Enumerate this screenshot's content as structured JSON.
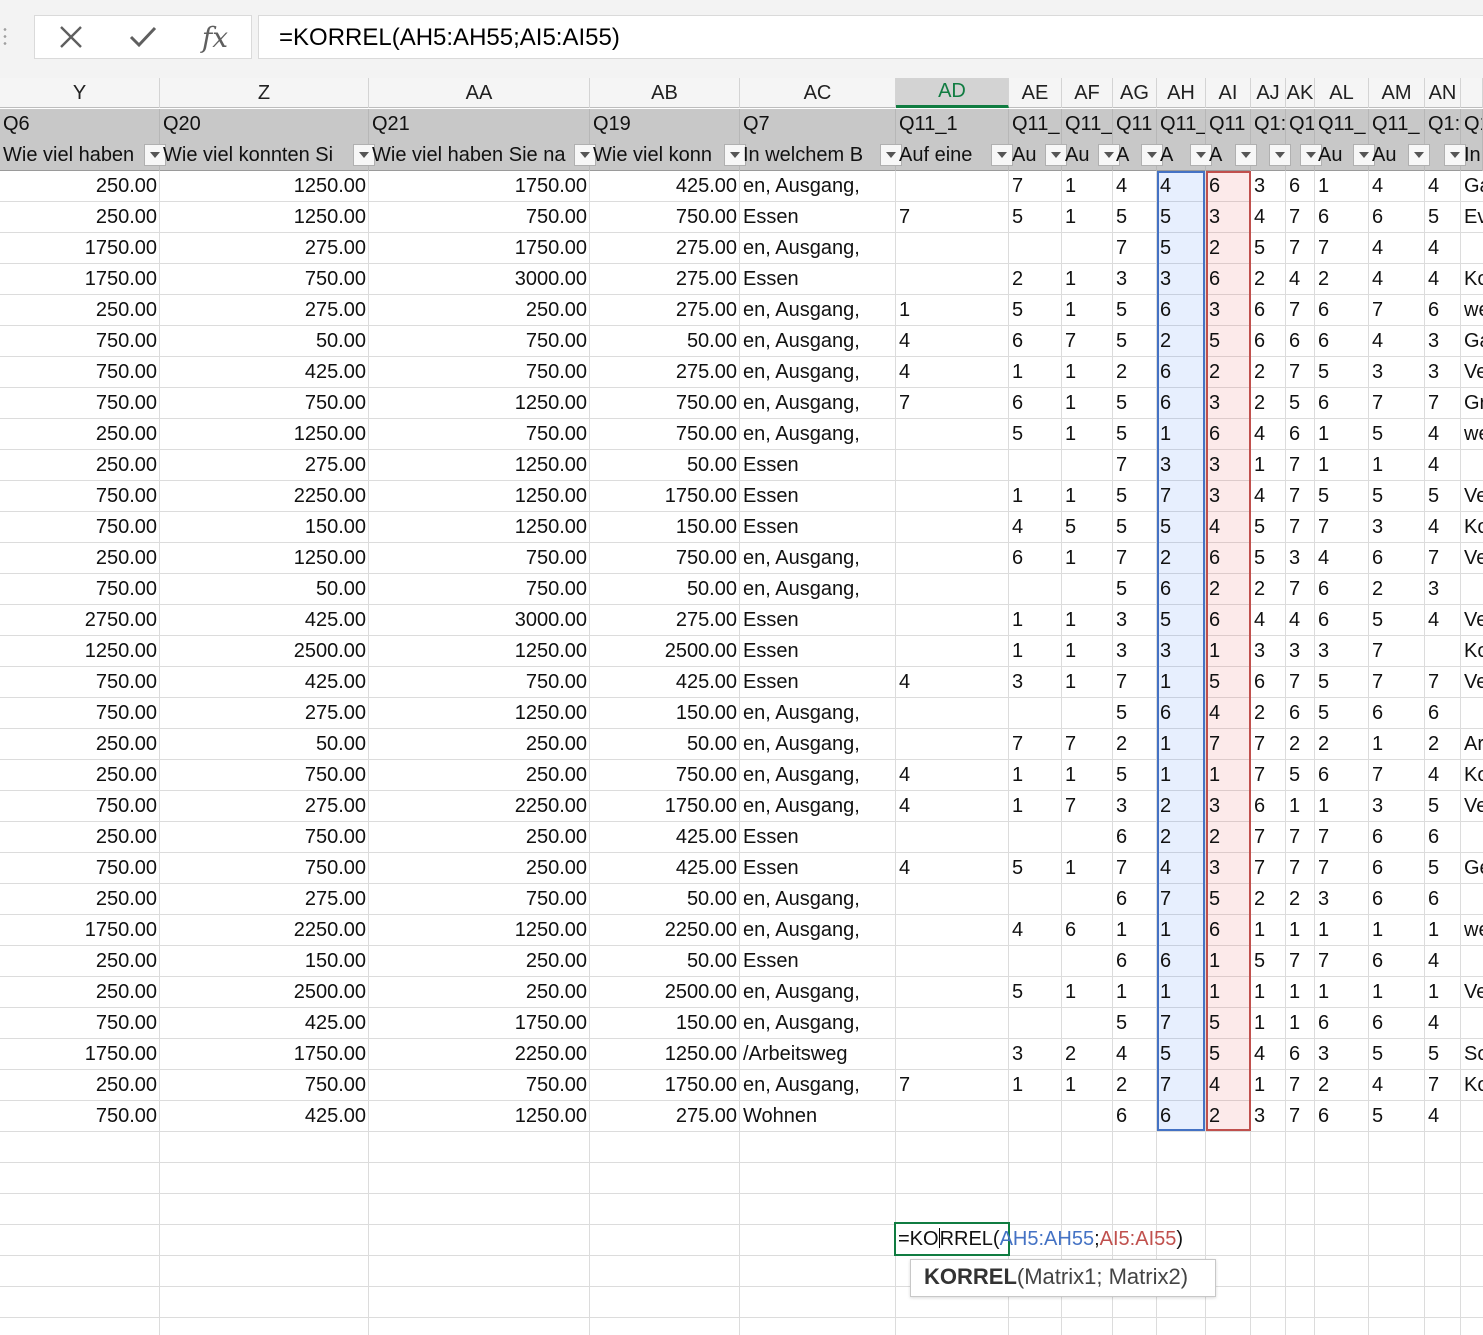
{
  "formula_bar": {
    "cancel_icon": "close-icon",
    "confirm_icon": "checkmark-icon",
    "fx_label": "fx",
    "formula": "=KORREL(AH5:AH55;AI5:AI55)"
  },
  "columns": [
    {
      "id": "col-y",
      "letter": "Y",
      "h1": "Q6",
      "h2": "Wie viel haben",
      "type": "num"
    },
    {
      "id": "col-z",
      "letter": "Z",
      "h1": "Q20",
      "h2": "Wie viel konnten Si",
      "type": "num"
    },
    {
      "id": "col-aa",
      "letter": "AA",
      "h1": "Q21",
      "h2": "Wie viel haben Sie na",
      "type": "num"
    },
    {
      "id": "col-ab",
      "letter": "AB",
      "h1": "Q19",
      "h2": "Wie viel konn",
      "type": "num"
    },
    {
      "id": "col-ac",
      "letter": "AC",
      "h1": "Q7",
      "h2": "In welchem B",
      "type": "txt"
    },
    {
      "id": "col-ad",
      "letter": "AD",
      "h1": "Q11_1",
      "h2": "Auf eine",
      "type": "txt"
    },
    {
      "id": "col-ae",
      "letter": "AE",
      "h1": "Q11_",
      "h2": "Au",
      "type": "txt"
    },
    {
      "id": "col-af",
      "letter": "AF",
      "h1": "Q11_",
      "h2": "Au",
      "type": "txt"
    },
    {
      "id": "col-ag",
      "letter": "AG",
      "h1": "Q11",
      "h2": "A",
      "type": "txt"
    },
    {
      "id": "col-ah",
      "letter": "AH",
      "h1": "Q11_",
      "h2": "A",
      "type": "txt"
    },
    {
      "id": "col-ai",
      "letter": "AI",
      "h1": "Q11",
      "h2": "A",
      "type": "txt"
    },
    {
      "id": "col-aj",
      "letter": "AJ",
      "h1": "Q1:",
      "h2": "",
      "type": "txt"
    },
    {
      "id": "col-ak",
      "letter": "AK",
      "h1": "Q1",
      "h2": "",
      "type": "txt"
    },
    {
      "id": "col-al",
      "letter": "AL",
      "h1": "Q11_",
      "h2": "Au",
      "type": "txt"
    },
    {
      "id": "col-am",
      "letter": "AM",
      "h1": "Q11_",
      "h2": "Au",
      "type": "txt"
    },
    {
      "id": "col-an",
      "letter": "AN",
      "h1": "Q1:",
      "h2": "",
      "type": "txt"
    },
    {
      "id": "col-ao",
      "letter": "",
      "h1": "Q1",
      "h2": "In",
      "type": "txt"
    }
  ],
  "active_column": "AD",
  "rows": [
    [
      "250.00",
      "1250.00",
      "1750.00",
      "425.00",
      "en, Ausgang,",
      "",
      "7",
      "1",
      "4",
      "4",
      "6",
      "3",
      "6",
      "1",
      "4",
      "4",
      "Ga"
    ],
    [
      "250.00",
      "1250.00",
      "750.00",
      "750.00",
      "Essen",
      "7",
      "5",
      "1",
      "5",
      "5",
      "3",
      "4",
      "7",
      "6",
      "6",
      "5",
      "Ev"
    ],
    [
      "1750.00",
      "275.00",
      "1750.00",
      "275.00",
      "en, Ausgang,",
      "",
      "",
      "",
      "7",
      "5",
      "2",
      "5",
      "7",
      "7",
      "4",
      "4",
      ""
    ],
    [
      "1750.00",
      "750.00",
      "3000.00",
      "275.00",
      "Essen",
      "",
      "2",
      "1",
      "3",
      "3",
      "6",
      "2",
      "4",
      "2",
      "4",
      "4",
      "Ko"
    ],
    [
      "250.00",
      "275.00",
      "250.00",
      "275.00",
      "en, Ausgang,",
      "1",
      "5",
      "1",
      "5",
      "6",
      "3",
      "6",
      "7",
      "6",
      "7",
      "6",
      "we"
    ],
    [
      "750.00",
      "50.00",
      "750.00",
      "50.00",
      "en, Ausgang,",
      "4",
      "6",
      "7",
      "5",
      "2",
      "5",
      "6",
      "6",
      "6",
      "4",
      "3",
      "Ga"
    ],
    [
      "750.00",
      "425.00",
      "750.00",
      "275.00",
      "en, Ausgang,",
      "4",
      "1",
      "1",
      "2",
      "6",
      "2",
      "2",
      "7",
      "5",
      "3",
      "3",
      "Ve"
    ],
    [
      "750.00",
      "750.00",
      "1250.00",
      "750.00",
      "en, Ausgang,",
      "7",
      "6",
      "1",
      "5",
      "6",
      "3",
      "2",
      "5",
      "6",
      "7",
      "7",
      "Gr"
    ],
    [
      "250.00",
      "1250.00",
      "750.00",
      "750.00",
      "en, Ausgang,",
      "",
      "5",
      "1",
      "5",
      "1",
      "6",
      "4",
      "6",
      "1",
      "5",
      "4",
      "we"
    ],
    [
      "250.00",
      "275.00",
      "1250.00",
      "50.00",
      "Essen",
      "",
      "",
      "",
      "7",
      "3",
      "3",
      "1",
      "7",
      "1",
      "1",
      "4",
      ""
    ],
    [
      "750.00",
      "2250.00",
      "1250.00",
      "1750.00",
      "Essen",
      "",
      "1",
      "1",
      "5",
      "7",
      "3",
      "4",
      "7",
      "5",
      "5",
      "5",
      "Ve"
    ],
    [
      "750.00",
      "150.00",
      "1250.00",
      "150.00",
      "Essen",
      "",
      "4",
      "5",
      "5",
      "5",
      "4",
      "5",
      "7",
      "7",
      "3",
      "4",
      "Ko"
    ],
    [
      "250.00",
      "1250.00",
      "750.00",
      "750.00",
      "en, Ausgang,",
      "",
      "6",
      "1",
      "7",
      "2",
      "6",
      "5",
      "3",
      "4",
      "6",
      "7",
      "Ve"
    ],
    [
      "750.00",
      "50.00",
      "750.00",
      "50.00",
      "en, Ausgang,",
      "",
      "",
      "",
      "5",
      "6",
      "2",
      "2",
      "7",
      "6",
      "2",
      "3",
      ""
    ],
    [
      "2750.00",
      "425.00",
      "3000.00",
      "275.00",
      "Essen",
      "",
      "1",
      "1",
      "3",
      "5",
      "6",
      "4",
      "4",
      "6",
      "5",
      "4",
      "Ve"
    ],
    [
      "1250.00",
      "2500.00",
      "1250.00",
      "2500.00",
      "Essen",
      "",
      "1",
      "1",
      "3",
      "3",
      "1",
      "3",
      "3",
      "3",
      "7",
      "",
      "Ko"
    ],
    [
      "750.00",
      "425.00",
      "750.00",
      "425.00",
      "Essen",
      "4",
      "3",
      "1",
      "7",
      "1",
      "5",
      "6",
      "7",
      "5",
      "7",
      "7",
      "Ve"
    ],
    [
      "750.00",
      "275.00",
      "1250.00",
      "150.00",
      "en, Ausgang,",
      "",
      "",
      "",
      "5",
      "6",
      "4",
      "2",
      "6",
      "5",
      "6",
      "6",
      ""
    ],
    [
      "250.00",
      "50.00",
      "250.00",
      "50.00",
      "en, Ausgang,",
      "",
      "7",
      "7",
      "2",
      "1",
      "7",
      "7",
      "2",
      "2",
      "1",
      "2",
      "Ar"
    ],
    [
      "250.00",
      "750.00",
      "250.00",
      "750.00",
      "en, Ausgang,",
      "4",
      "1",
      "1",
      "5",
      "1",
      "1",
      "7",
      "5",
      "6",
      "7",
      "4",
      "Ko"
    ],
    [
      "750.00",
      "275.00",
      "2250.00",
      "1750.00",
      "en, Ausgang,",
      "4",
      "1",
      "7",
      "3",
      "2",
      "3",
      "6",
      "1",
      "1",
      "3",
      "5",
      "Ve"
    ],
    [
      "250.00",
      "750.00",
      "250.00",
      "425.00",
      "Essen",
      "",
      "",
      "",
      "6",
      "2",
      "2",
      "7",
      "7",
      "7",
      "6",
      "6",
      ""
    ],
    [
      "750.00",
      "750.00",
      "250.00",
      "425.00",
      "Essen",
      "4",
      "5",
      "1",
      "7",
      "4",
      "3",
      "7",
      "7",
      "7",
      "6",
      "5",
      "Ge"
    ],
    [
      "250.00",
      "275.00",
      "750.00",
      "50.00",
      "en, Ausgang,",
      "",
      "",
      "",
      "6",
      "7",
      "5",
      "2",
      "2",
      "3",
      "6",
      "6",
      ""
    ],
    [
      "1750.00",
      "2250.00",
      "1250.00",
      "2250.00",
      "en, Ausgang,",
      "",
      "4",
      "6",
      "1",
      "1",
      "6",
      "1",
      "1",
      "1",
      "1",
      "1",
      "we"
    ],
    [
      "250.00",
      "150.00",
      "250.00",
      "50.00",
      "Essen",
      "",
      "",
      "",
      "6",
      "6",
      "1",
      "5",
      "7",
      "7",
      "6",
      "4",
      ""
    ],
    [
      "250.00",
      "2500.00",
      "250.00",
      "2500.00",
      "en, Ausgang,",
      "",
      "5",
      "1",
      "1",
      "1",
      "1",
      "1",
      "1",
      "1",
      "1",
      "1",
      "Ve"
    ],
    [
      "750.00",
      "425.00",
      "1750.00",
      "150.00",
      "en, Ausgang,",
      "",
      "",
      "",
      "5",
      "7",
      "5",
      "1",
      "1",
      "6",
      "6",
      "4",
      ""
    ],
    [
      "1750.00",
      "1750.00",
      "2250.00",
      "1250.00",
      "/Arbeitsweg",
      "",
      "3",
      "2",
      "4",
      "5",
      "5",
      "4",
      "6",
      "3",
      "5",
      "5",
      "So"
    ],
    [
      "250.00",
      "750.00",
      "750.00",
      "1750.00",
      "en, Ausgang,",
      "7",
      "1",
      "1",
      "2",
      "7",
      "4",
      "1",
      "7",
      "2",
      "4",
      "7",
      "Ko"
    ],
    [
      "750.00",
      "425.00",
      "1250.00",
      "275.00",
      "Wohnen",
      "",
      "",
      "",
      "6",
      "6",
      "2",
      "3",
      "7",
      "6",
      "5",
      "4",
      ""
    ]
  ],
  "editor": {
    "prefix_before_caret": "=KO",
    "prefix_after_caret": "RREL(",
    "range1": "AH5:AH55",
    "separator": ";",
    "range2": "AI5:AI55",
    "suffix": ")"
  },
  "tooltip": {
    "function_name": "KORREL",
    "args": "(Matrix1; Matrix2)"
  },
  "colors": {
    "range1": "#4472c4",
    "range2": "#c0504d",
    "active": "#107c41"
  }
}
